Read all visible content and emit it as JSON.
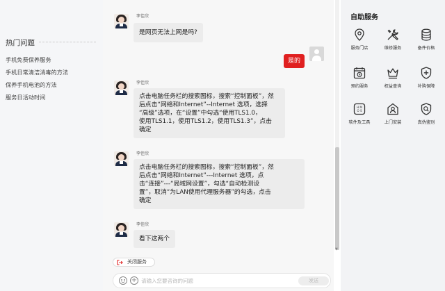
{
  "hot_questions": {
    "title": "热门问题",
    "items": [
      "手机免费保养服务",
      "手机日常清洁消毒的方法",
      "保养手机电池的方法",
      "服务日活动时间"
    ]
  },
  "chat": {
    "messages": [
      {
        "from": "agent",
        "name": "李佳欣",
        "text": "是网页无法上网是吗?"
      },
      {
        "from": "user",
        "text": "是的"
      },
      {
        "from": "agent",
        "name": "李佳欣",
        "lines": [
          "点击电脑任务栏的搜索图标，搜索“控制面板”，然",
          "后点击“网络和Internet”--Internet 选项，选择",
          "“高级”选项，在“设置”中勾选“使用TLS1.0，",
          "使用TLS1.1，使用TLS1.2，使用TLS1.3”，点击",
          "确定"
        ]
      },
      {
        "from": "agent",
        "name": "李佳欣",
        "lines": [
          "点击电脑任务栏的搜索图标，搜索“控制面板”，然",
          "后点击“网络和Internet”---Internet 选项，点",
          "击“连接”---“局域网设置”，勾选“自动检测设",
          "置”，取消“为LAN使用代理服务器”的勾选，点击",
          "确定"
        ]
      },
      {
        "from": "agent",
        "name": "李佳欣",
        "text": "看下这两个"
      }
    ],
    "close_service_label": "关闭服务",
    "input_placeholder": "请输入您要咨询的问题",
    "send_label": "发送",
    "accent_color": "#e02020"
  },
  "self_service": {
    "title": "自助服务",
    "items": [
      {
        "label": "服务门店",
        "icon": "location-pin-icon"
      },
      {
        "label": "维修服务",
        "icon": "tools-icon"
      },
      {
        "label": "备件价格",
        "icon": "database-icon"
      },
      {
        "label": "预约服务",
        "icon": "calendar-icon"
      },
      {
        "label": "权益查询",
        "icon": "crown-icon"
      },
      {
        "label": "补购保障",
        "icon": "shield-plus-icon"
      },
      {
        "label": "软件及工具",
        "icon": "hmos-icon"
      },
      {
        "label": "上门安装",
        "icon": "home-user-icon"
      },
      {
        "label": "真伪鉴别",
        "icon": "shield-search-icon"
      }
    ]
  }
}
